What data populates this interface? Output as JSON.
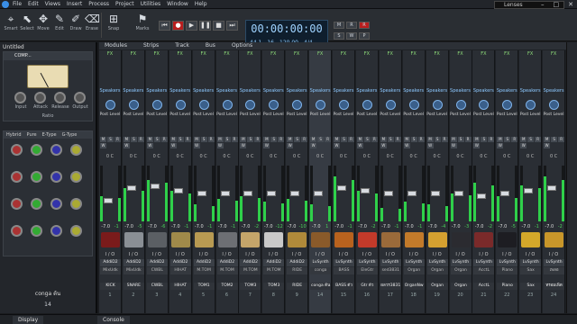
{
  "menu": {
    "items": [
      "File",
      "Edit",
      "Views",
      "Insert",
      "Process",
      "Project",
      "Utilities",
      "Window",
      "Help"
    ]
  },
  "toolbar": {
    "tools": [
      {
        "label": "Smart",
        "icon": "⌖"
      },
      {
        "label": "Select",
        "icon": "⬉"
      },
      {
        "label": "Move",
        "icon": "✥"
      },
      {
        "label": "Edit",
        "icon": "✎"
      },
      {
        "label": "Draw",
        "icon": "✐"
      },
      {
        "label": "Erase",
        "icon": "⌫"
      }
    ],
    "snap": "Snap",
    "marks": "Marks",
    "preset": "Lenses"
  },
  "transport": {
    "timecode": "00:00:00:00",
    "bars": "44.1",
    "bits": "16",
    "tempo": "120.00",
    "meter": "4/4"
  },
  "leftpanel": {
    "title": "Untitled",
    "plugin": "COMP...",
    "knobs": [
      "Input",
      "Attack",
      "Release",
      "Output"
    ],
    "ratio": "Ratio",
    "fx_tabs": [
      "Hybrid",
      "Pure",
      "E-Type",
      "G-Type"
    ],
    "channel_name": "conga ต้น",
    "channel_number": "14"
  },
  "mixer": {
    "tabs": [
      "Modules",
      "Strips",
      "Track",
      "Bus",
      "Options"
    ],
    "fx": "FX",
    "speakers": "Speakers",
    "post": "Post Level",
    "pan": "0 C",
    "io": "I / O",
    "strips": [
      {
        "vol": "-7.0",
        "pan": "-1",
        "inst": "AddiD2",
        "sub": "MixUdk",
        "name": "KICK",
        "num": "1",
        "color": "#7a1b1b",
        "meter": 0.45,
        "fader": 0.35
      },
      {
        "vol": "-7.0",
        "pan": "-5",
        "inst": "AddiD2",
        "sub": "MixUdk",
        "name": "SNARE",
        "num": "2",
        "color": "#8a8f95",
        "meter": 0.6,
        "fader": 0.6
      },
      {
        "vol": "-7.0",
        "pan": "-6",
        "inst": "AddiD2",
        "sub": "CWBL",
        "name": "CWBL",
        "num": "3",
        "color": "#5b5f64",
        "meter": 0.75,
        "fader": 0.65
      },
      {
        "vol": "-7.0",
        "pan": "-1",
        "inst": "AddiD2",
        "sub": "HIHAT",
        "name": "HIHAT",
        "num": "4",
        "color": "#a08a4a",
        "meter": 0.55,
        "fader": 0.55
      },
      {
        "vol": "-7.0",
        "pan": "-1",
        "inst": "AddiD2",
        "sub": "M.TOM",
        "name": "TOM1",
        "num": "5",
        "color": "#b89a52",
        "meter": 0.3,
        "fader": 0.5
      },
      {
        "vol": "-7.0",
        "pan": "-1",
        "inst": "AddiD2",
        "sub": "M.TOM",
        "name": "TOM2",
        "num": "6",
        "color": "#6d6f74",
        "meter": 0.4,
        "fader": 0.5
      },
      {
        "vol": "-7.0",
        "pan": "-2",
        "inst": "AddiD2",
        "sub": "M.TOM",
        "name": "TOM3",
        "num": "7",
        "color": "#c4a56a",
        "meter": 0.45,
        "fader": 0.5
      },
      {
        "vol": "-7.0",
        "pan": "-12",
        "inst": "AddiD2",
        "sub": "M.TOM",
        "name": "TOM3",
        "num": "8",
        "color": "#c9c9c9",
        "meter": 0.35,
        "fader": 0.5
      },
      {
        "vol": "-7.0",
        "pan": "-10",
        "inst": "AddiD2",
        "sub": "RIDE",
        "name": "RIDE",
        "num": "9",
        "color": "#b08a3a",
        "meter": 0.4,
        "fader": 0.5
      },
      {
        "vol": "-7.0",
        "pan": "1",
        "inst": "LvSynth",
        "sub": "conga",
        "name": "conga ต้น",
        "num": "14",
        "color": "#8a5a2a",
        "meter": 0.3,
        "fader": 0.5
      },
      {
        "vol": "-7.0",
        "pan": "-1",
        "inst": "LvSynth",
        "sub": "BASS",
        "name": "BASS ตัว",
        "num": "15",
        "color": "#b8621e",
        "meter": 0.8,
        "fader": 0.6
      },
      {
        "vol": "-7.0",
        "pan": "-2",
        "inst": "LvSynth",
        "sub": "EleGtr",
        "name": "Gtr ตัว",
        "num": "16",
        "color": "#c23a2a",
        "meter": 0.55,
        "fader": 0.55
      },
      {
        "vol": "-7.0",
        "pan": "-1",
        "inst": "LvSynth",
        "sub": "sed3831",
        "name": "ผลวร3831",
        "num": "17",
        "color": "#9a6a3a",
        "meter": 0.25,
        "fader": 0.5
      },
      {
        "vol": "-7.0",
        "pan": "-1",
        "inst": "LvSynth",
        "sub": "Organ",
        "name": "OrganNw",
        "num": "18",
        "color": "#c27a2a",
        "meter": 0.35,
        "fader": 0.5
      },
      {
        "vol": "-7.0",
        "pan": "-4",
        "inst": "LvSynth",
        "sub": "Organ",
        "name": "Organ",
        "num": "19",
        "color": "#d4a030",
        "meter": 0.3,
        "fader": 0.5
      },
      {
        "vol": "-7.0",
        "pan": "-3",
        "inst": "LvSynth",
        "sub": "Organ",
        "name": "Organ",
        "num": "20",
        "color": "#2b2b30",
        "meter": 0.5,
        "fader": 0.5
      },
      {
        "vol": "-7.0",
        "pan": "-2",
        "inst": "LvSynth",
        "sub": "AcctL",
        "name": "AcctL",
        "num": "21",
        "color": "#7a2a2a",
        "meter": 0.7,
        "fader": 0.45
      },
      {
        "vol": "-7.0",
        "pan": "-5",
        "inst": "LvSynth",
        "sub": "Piano",
        "name": "Piano",
        "num": "22",
        "color": "#1d1d22",
        "meter": 0.45,
        "fader": 0.5
      },
      {
        "vol": "-7.0",
        "pan": "-1",
        "inst": "LvSynth",
        "sub": "Sax",
        "name": "Sax",
        "num": "23",
        "color": "#d4a82a",
        "meter": 0.65,
        "fader": 0.55
      },
      {
        "vol": "-7.0",
        "pan": "-2",
        "inst": "LvSynth",
        "sub": "เพลอ",
        "name": "ทรอมเพ็ต",
        "num": "24",
        "color": "#c8962a",
        "meter": 0.8,
        "fader": 0.6
      }
    ]
  },
  "bottom": {
    "display": "Display",
    "console": "Console"
  }
}
